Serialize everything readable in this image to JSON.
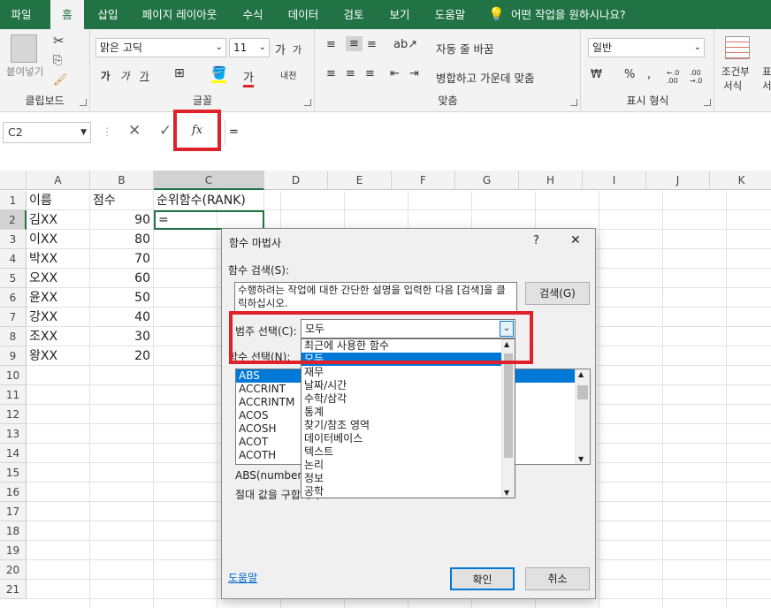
{
  "tabs": [
    "파일",
    "홈",
    "삽입",
    "페이지 레이아웃",
    "수식",
    "데이터",
    "검토",
    "보기",
    "도움말"
  ],
  "tell_me": "어떤 작업을 원하시나요?",
  "ribbon": {
    "paste_label": "붙여넣기",
    "font_name": "맑은 고딕",
    "font_size": "11",
    "grow_font": "가",
    "shrink_font": "가",
    "bold": "가",
    "italic": "가",
    "underline": "가",
    "font_color_letter": "가",
    "phonetic": "내천",
    "wrap_text": "자동 줄 바꿈",
    "merge_center": "병합하고 가운데 맞춤",
    "number_format": "일반",
    "conditional_format_1": "조건부",
    "conditional_format_2": "서식",
    "format_as_table_1": "표",
    "format_as_table_2": "서",
    "groups": {
      "clipboard": "클립보드",
      "font": "글꼴",
      "alignment": "맞춤",
      "number": "표시 형식"
    },
    "currency_symbol": "₩",
    "percent_symbol": "%",
    "comma_symbol": ",",
    "inc_decimal": "←.0 .00",
    "dec_decimal": ".00 →.0"
  },
  "formula_bar": {
    "name_box": "C2",
    "fx": "fx",
    "value": "="
  },
  "columns": [
    "A",
    "B",
    "C",
    "D",
    "E",
    "F",
    "G",
    "H",
    "I",
    "J",
    "K"
  ],
  "rows": [
    "1",
    "2",
    "3",
    "4",
    "5",
    "6",
    "7",
    "8",
    "9",
    "10",
    "11",
    "12",
    "13",
    "14",
    "15",
    "16",
    "17",
    "18",
    "19",
    "20",
    "21"
  ],
  "sheet": {
    "A1": "이름",
    "B1": "점수",
    "C1": "순위함수(RANK)",
    "C2": "=",
    "names": [
      "김XX",
      "이XX",
      "박XX",
      "오XX",
      "윤XX",
      "강XX",
      "조XX",
      "왕XX"
    ],
    "scores": [
      "90",
      "80",
      "70",
      "60",
      "50",
      "40",
      "30",
      "20"
    ]
  },
  "dialog": {
    "title": "함수 마법사",
    "help_q": "?",
    "close": "✕",
    "search_label": "함수 검색(S):",
    "search_text": "수행하려는 작업에 대한 간단한 설명을 입력한 다음 [검색]을 클릭하십시오.",
    "search_button": "검색(G)",
    "category_label": "범주 선택(C):",
    "category_value": "모두",
    "select_label": "함수 선택(N):",
    "category_options": [
      "최근에 사용한 함수",
      "모두",
      "재무",
      "날짜/시간",
      "수학/삼각",
      "통계",
      "찾기/참조 영역",
      "데이터베이스",
      "텍스트",
      "논리",
      "정보",
      "공학"
    ],
    "functions": [
      "ABS",
      "ACCRINT",
      "ACCRINTM",
      "ACOS",
      "ACOSH",
      "ACOT",
      "ACOTH"
    ],
    "signature": "ABS(number)",
    "description": "절대 값을 구합니다.",
    "help_link": "도움말",
    "ok": "확인",
    "cancel": "취소"
  },
  "colors": {
    "ribbon_green": "#217346",
    "highlight_red": "#e0202a",
    "selection_blue": "#0078d7"
  }
}
